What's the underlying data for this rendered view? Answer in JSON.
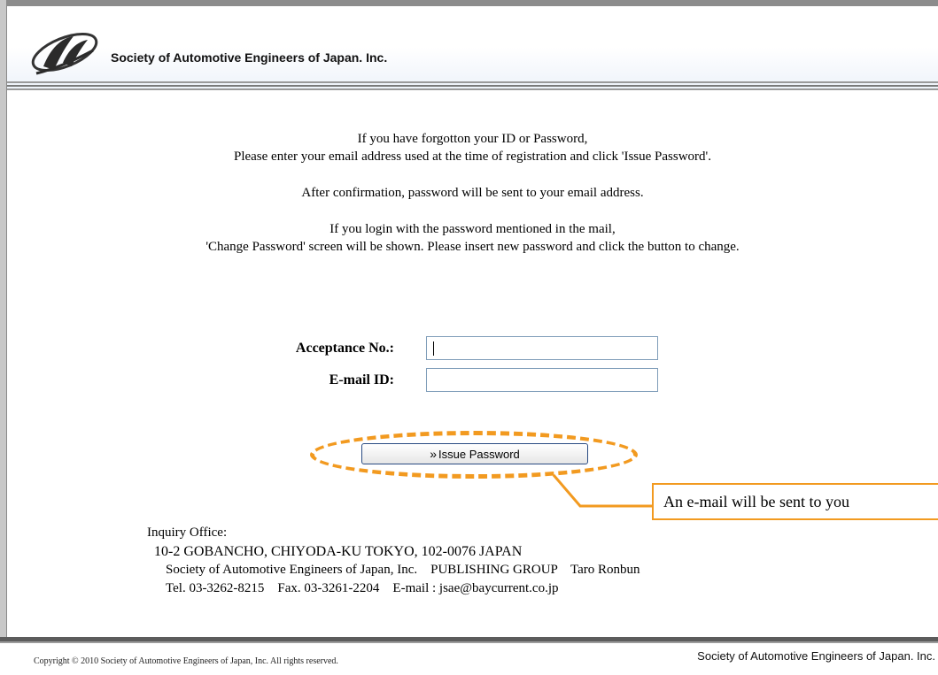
{
  "header": {
    "org_name": "Society of Automotive Engineers of Japan. Inc."
  },
  "intro": {
    "line1": "If you have forgotton your ID or Password,",
    "line2": "Please enter your email address used at the time of registration and click 'Issue Password'.",
    "line3": "After confirmation, password will be sent to your email address.",
    "line4": "If you login with the password mentioned in the mail,",
    "line5": "'Change Password' screen will be shown. Please insert new password and click the button to change."
  },
  "form": {
    "acceptance_label": "Acceptance No.:",
    "acceptance_value": "",
    "email_label": "E-mail ID:",
    "email_value": "",
    "issue_button_label": "Issue Password",
    "issue_button_icon": "double-chevron-right-icon"
  },
  "callout": {
    "text": "An e-mail will be sent to you",
    "color": "#f29a20"
  },
  "inquiry": {
    "title": "Inquiry Office:",
    "address": "10-2 GOBANCHO, CHIYODA-KU TOKYO, 102-0076 JAPAN",
    "org": "Society of Automotive Engineers of Japan, Inc.    PUBLISHING GROUP    Taro Ronbun",
    "contact": "Tel. 03-3262-8215    Fax. 03-3261-2204    E-mail : jsae@baycurrent.co.jp"
  },
  "footer": {
    "copyright": "Copyright © 2010 Society of Automotive Engineers of Japan, Inc. All rights reserved.",
    "org_name": "Society of Automotive Engineers of Japan. Inc."
  }
}
